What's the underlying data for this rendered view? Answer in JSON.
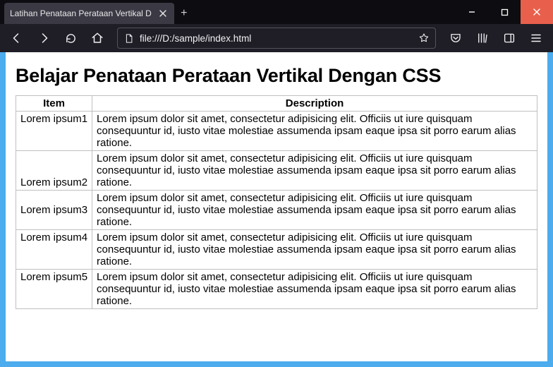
{
  "window": {
    "tab_title": "Latihan Penataan Perataan Vertikal D",
    "minimize": "–",
    "maximize": "□",
    "close": "×",
    "newtab": "+"
  },
  "toolbar": {
    "url": "file:///D:/sample/index.html"
  },
  "page": {
    "heading": "Belajar Penataan Perataan Vertikal Dengan CSS",
    "columns": {
      "item": "Item",
      "desc": "Description"
    },
    "desc_text": "Lorem ipsum dolor sit amet, consectetur adipisicing elit. Officiis ut iure quisquam consequuntur id, iusto vitae molestiae assumenda ipsam eaque ipsa sit porro earum alias ratione.",
    "rows": [
      {
        "item": "Lorem ipsum1"
      },
      {
        "item": "Lorem ipsum2"
      },
      {
        "item": "Lorem ipsum3"
      },
      {
        "item": "Lorem ipsum4"
      },
      {
        "item": "Lorem ipsum5"
      }
    ]
  }
}
